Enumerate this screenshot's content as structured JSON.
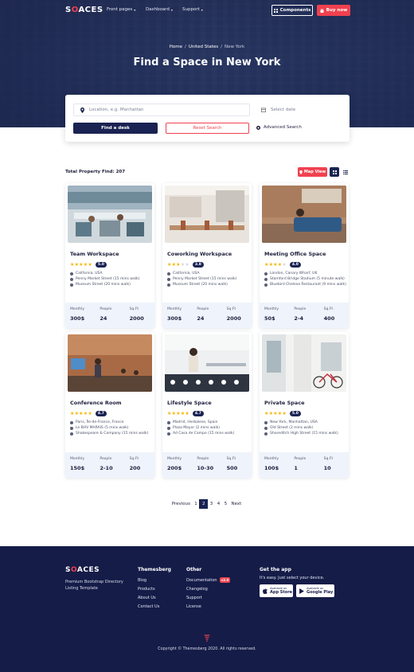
{
  "brand": {
    "logo_pre": "S",
    "logo_o": "O",
    "logo_post": "ACES"
  },
  "nav": {
    "items": [
      "Front pages",
      "Dashboard",
      "Support"
    ],
    "components_label": "Components",
    "buy_label": "Buy now"
  },
  "hero": {
    "breadcrumb": [
      "Home",
      "United States",
      "New York"
    ],
    "title": "Find a Space in New York"
  },
  "search": {
    "location_placeholder": "Location, e.g. Manhattan",
    "date_placeholder": "Select date",
    "find_label": "Find a desk",
    "reset_label": "Reset Search",
    "advanced_label": "Advanced Search"
  },
  "results": {
    "total_label": "Total Property Find: 207",
    "map_view_label": "Map View"
  },
  "stat_labels": {
    "monthly": "Monthly",
    "people": "People",
    "sqft": "Sq.Ft"
  },
  "cards": [
    {
      "title": "Team Workspace",
      "stars": 5,
      "score": "5.0",
      "addr": [
        "California, USA",
        "Penny Market Street (15 mins walk)",
        "Museum Street (20 mins walk)"
      ],
      "monthly": "300$",
      "people": "24",
      "sqft": "2000"
    },
    {
      "title": "Coworking Workspace",
      "stars": 3,
      "score": "3.8",
      "addr": [
        "California, USA",
        "Penny Market Street (15 mins walk)",
        "Museum Street (20 mins walk)"
      ],
      "monthly": "300$",
      "people": "24",
      "sqft": "2000"
    },
    {
      "title": "Meeting Office Space",
      "stars": 4,
      "score": "4.0",
      "addr": [
        "London, Canary Wharf, UK",
        "Stamford Bridge Stadium (5 minute walk)",
        "Bluebird Chelsea Restaurant (9 mins walk)"
      ],
      "monthly": "50$",
      "people": "2-4",
      "sqft": "400"
    },
    {
      "title": "Conference Room",
      "stars": 5,
      "score": "4.7",
      "addr": [
        "Paris, Île-de-France, France",
        "Le BHV MARAIS (5 mins walk)",
        "Shakespeare & Company (15 mins walk)"
      ],
      "monthly": "150$",
      "people": "2-10",
      "sqft": "200"
    },
    {
      "title": "Lifestyle Space",
      "stars": 5,
      "score": "4.7",
      "addr": [
        "Madrid, Herbalese, Spain",
        "Plaza Mayor (2 mins walk)",
        "Ad Casa de Campo (15 mins walk)"
      ],
      "monthly": "200$",
      "people": "10-30",
      "sqft": "500"
    },
    {
      "title": "Private Space",
      "stars": 5,
      "score": "5.0",
      "addr": [
        "New York, Manhattan, USA",
        "Old Street (2 mins walk)",
        "Shoreditch High Street (15 mins walk)"
      ],
      "monthly": "100$",
      "people": "1",
      "sqft": "10"
    }
  ],
  "pagination": {
    "prev": "Previous",
    "pages": [
      "1",
      "2",
      "3",
      "4",
      "5"
    ],
    "active": "2",
    "next": "Next"
  },
  "footer": {
    "logo_pre": "S",
    "logo_o": "O",
    "logo_post": "ACES",
    "description": "Premium Bootstrap Directory Listing Template",
    "col1_title": "Themesberg",
    "col1_links": [
      "Blog",
      "Products",
      "About Us",
      "Contact Us"
    ],
    "col2_title": "Other",
    "col2_links": [
      "Documentation",
      "Changelog",
      "Support",
      "License"
    ],
    "version_badge": "v3.0",
    "app_title": "Get the app",
    "app_text": "It's easy. Just select your device.",
    "appstore_small": "Available on",
    "appstore_big": "App Store",
    "googleplay_small": "Available on",
    "googleplay_big": "Google Play",
    "copyright": "Copyright © Themesberg 2020. All rights reserved."
  },
  "colors": {
    "navy": "#1a2352",
    "accent": "#f0414f",
    "star": "#f5b400",
    "footer_bg": "#151c48"
  }
}
